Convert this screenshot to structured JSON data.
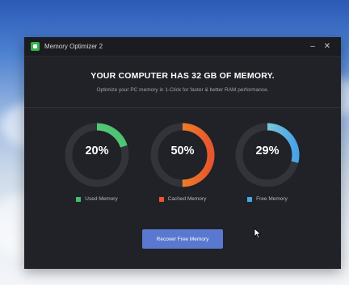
{
  "window": {
    "title": "Memory Optimizer 2",
    "minimize_glyph": "–",
    "close_glyph": "✕",
    "icon": "app-icon"
  },
  "header": {
    "headline": "YOUR COMPUTER HAS 32 GB OF MEMORY.",
    "subtitle": "Optimize your PC memory in 1-Click for faster & better RAM performance."
  },
  "gauges": [
    {
      "value_label": "20%",
      "percent": 20,
      "legend": "Used Memory",
      "color": "#3fbf6a",
      "gradient_to": "#9be0a2"
    },
    {
      "value_label": "50%",
      "percent": 50,
      "legend": "Cached Memory",
      "color": "#e8552e",
      "gradient_to": "#f5a623"
    },
    {
      "value_label": "29%",
      "percent": 29,
      "legend": "Free Memory",
      "color": "#4aa3e8",
      "gradient_to": "#a9ecc8"
    }
  ],
  "actions": {
    "recover_label": "Recover Free Memory"
  },
  "colors": {
    "track": "#32343a",
    "window_bg": "#202227",
    "button": "#5a78cf"
  }
}
